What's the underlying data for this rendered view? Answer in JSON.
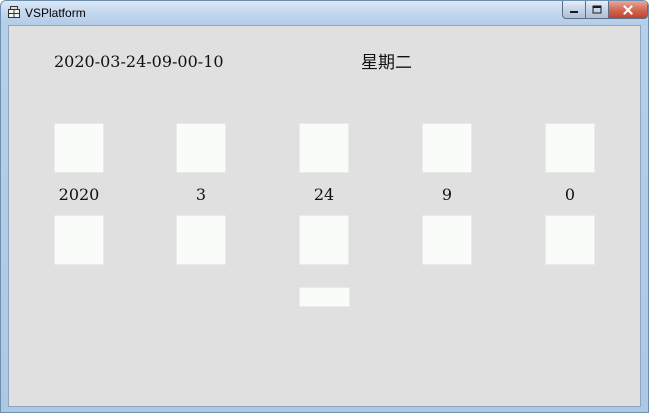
{
  "window": {
    "title": "VSPlatform"
  },
  "display": {
    "datetime": "2020-03-24-09-00-10",
    "weekday": "星期二"
  },
  "values": [
    "2020",
    "3",
    "24",
    "9",
    "0"
  ],
  "colors": {
    "client_background": "#e0e0e0",
    "box_fill": "#fafcfa",
    "close_button": "#c0442e"
  },
  "icons": {
    "app": "app-icon",
    "minimize": "minimize-icon",
    "maximize": "maximize-icon",
    "close": "close-icon"
  }
}
